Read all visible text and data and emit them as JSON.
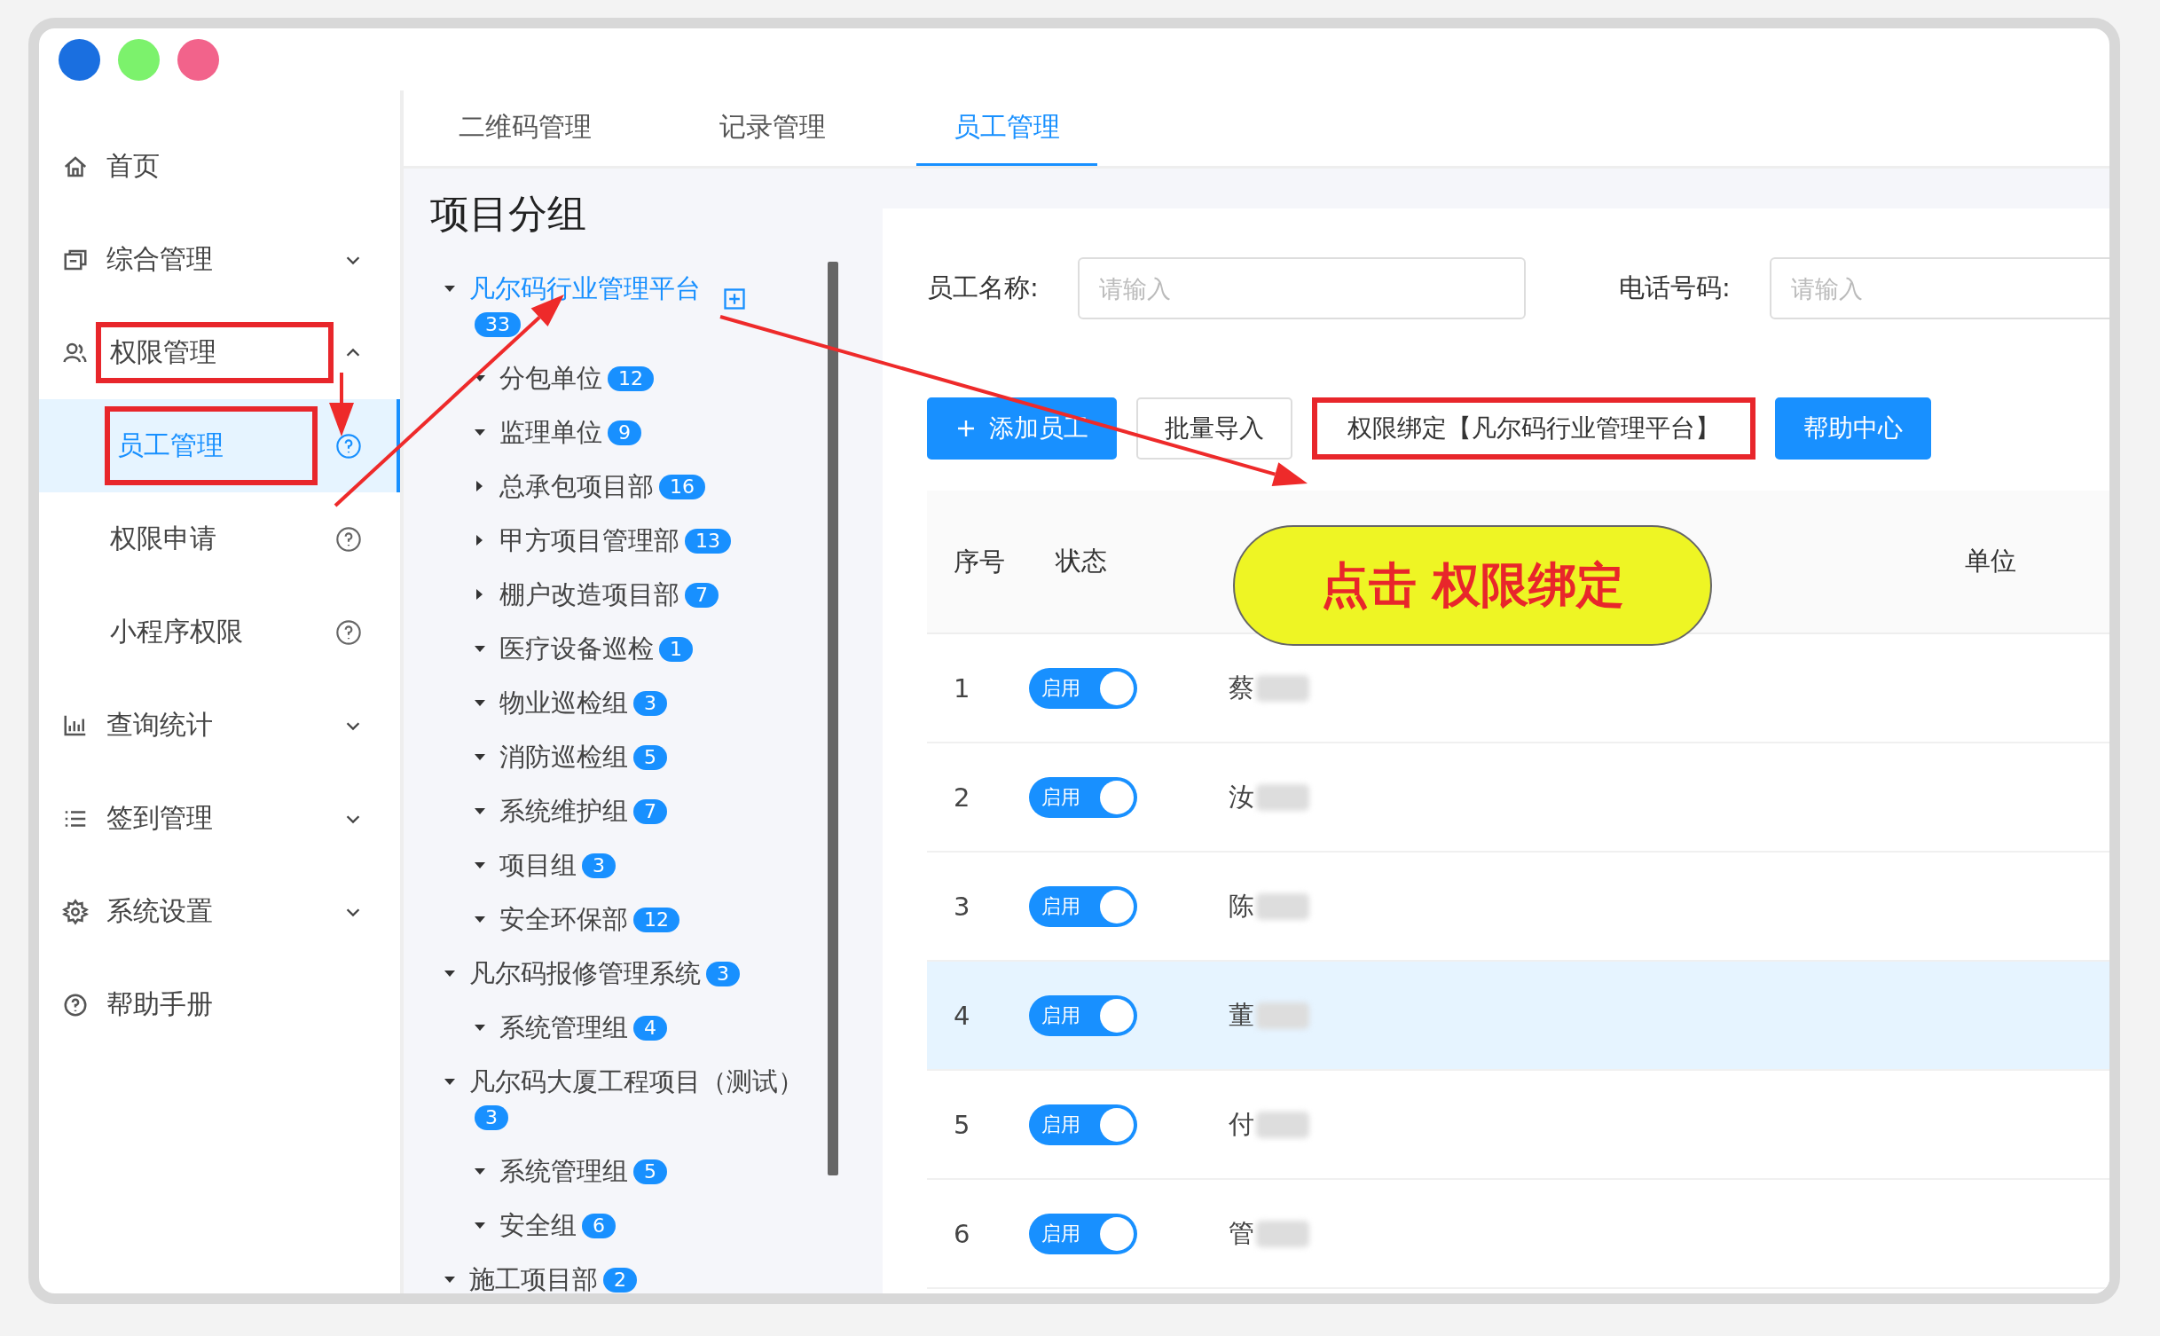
{
  "sidebar": {
    "items": [
      {
        "label": "首页",
        "selected": false
      },
      {
        "label": "综合管理",
        "expanded": false,
        "selected": false
      },
      {
        "label": "权限管理",
        "expanded": true,
        "selected": false,
        "annotated": true,
        "children": [
          {
            "label": "员工管理",
            "selected": true,
            "annotated": true
          },
          {
            "label": "权限申请",
            "selected": false,
            "annotated": false
          },
          {
            "label": "小程序权限",
            "selected": false,
            "annotated": false
          }
        ]
      },
      {
        "label": "查询统计",
        "expanded": false,
        "selected": false
      },
      {
        "label": "签到管理",
        "expanded": false,
        "selected": false
      },
      {
        "label": "系统设置",
        "expanded": false,
        "selected": false
      },
      {
        "label": "帮助手册",
        "selected": false
      }
    ]
  },
  "tabs": [
    {
      "label": "二维码管理",
      "selected": false
    },
    {
      "label": "记录管理",
      "selected": false
    },
    {
      "label": "员工管理",
      "selected": true
    }
  ],
  "tree": {
    "title": "项目分组",
    "items": [
      {
        "label": "凡尔码行业管理平台",
        "count": "33",
        "selected": true,
        "expanded": true,
        "children": [
          {
            "label": "分包单位",
            "count": "12",
            "selected": false,
            "expanded": true
          },
          {
            "label": "监理单位",
            "count": "9",
            "selected": false,
            "expanded": true
          },
          {
            "label": "总承包项目部",
            "count": "16",
            "selected": false,
            "expanded": false
          },
          {
            "label": "甲方项目管理部",
            "count": "13",
            "selected": false,
            "expanded": false
          },
          {
            "label": "棚户改造项目部",
            "count": "7",
            "selected": false,
            "expanded": false
          },
          {
            "label": "医疗设备巡检",
            "count": "1",
            "selected": false,
            "expanded": true
          },
          {
            "label": "物业巡检组",
            "count": "3",
            "selected": false,
            "expanded": true
          },
          {
            "label": "消防巡检组",
            "count": "5",
            "selected": false,
            "expanded": true
          },
          {
            "label": "系统维护组",
            "count": "7",
            "selected": false,
            "expanded": true
          },
          {
            "label": "项目组",
            "count": "3",
            "selected": false,
            "expanded": true
          },
          {
            "label": "安全环保部",
            "count": "12",
            "selected": false,
            "expanded": true
          }
        ]
      },
      {
        "label": "凡尔码报修管理系统",
        "count": "3",
        "selected": false,
        "expanded": true,
        "children": [
          {
            "label": "系统管理组",
            "count": "4",
            "selected": false,
            "expanded": true
          }
        ]
      },
      {
        "label": "凡尔码大厦工程项目（测试）",
        "count": "3",
        "selected": false,
        "expanded": true,
        "children": [
          {
            "label": "系统管理组",
            "count": "5",
            "selected": false,
            "expanded": true
          },
          {
            "label": "安全组",
            "count": "6",
            "selected": false,
            "expanded": true
          }
        ]
      },
      {
        "label": "施工项目部",
        "count": "2",
        "selected": false,
        "expanded": true
      }
    ]
  },
  "filters": [
    {
      "label": "员工名称:",
      "placeholder": "请输入"
    },
    {
      "label": "电话号码:",
      "placeholder": "请输入"
    }
  ],
  "buttons": [
    {
      "label": "添加员工",
      "kind": "add",
      "annotated": false
    },
    {
      "label": "批量导入",
      "kind": "default",
      "annotated": false
    },
    {
      "label": "权限绑定【凡尔码行业管理平台】",
      "kind": "default",
      "annotated": true
    },
    {
      "label": "帮助中心",
      "kind": "primary",
      "annotated": false
    }
  ],
  "table": {
    "columns": [
      "序号",
      "状态",
      "单位"
    ],
    "rows": [
      {
        "index": "1",
        "status": "启用",
        "on": true,
        "name": "蔡",
        "selected": false
      },
      {
        "index": "2",
        "status": "启用",
        "on": true,
        "name": "汝",
        "selected": false
      },
      {
        "index": "3",
        "status": "启用",
        "on": true,
        "name": "陈",
        "selected": false
      },
      {
        "index": "4",
        "status": "启用",
        "on": true,
        "name": "董",
        "selected": true
      },
      {
        "index": "5",
        "status": "启用",
        "on": true,
        "name": "付",
        "selected": false
      },
      {
        "index": "6",
        "status": "启用",
        "on": true,
        "name": "管",
        "selected": false
      }
    ]
  },
  "callout": {
    "text": "点击 权限绑定"
  }
}
